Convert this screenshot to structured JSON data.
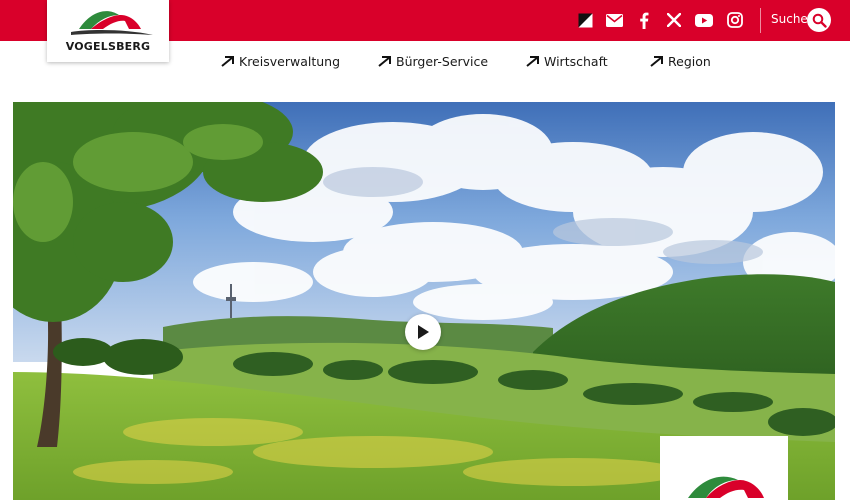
{
  "header": {
    "logo_text": "VOGELSBERG",
    "social": [
      {
        "name": "contrast-icon"
      },
      {
        "name": "mail-icon"
      },
      {
        "name": "facebook-icon"
      },
      {
        "name": "x-icon"
      },
      {
        "name": "youtube-icon"
      },
      {
        "name": "instagram-icon"
      }
    ],
    "search_label": "Suche"
  },
  "nav": {
    "items": [
      {
        "label": "Kreisverwaltung"
      },
      {
        "label": "Bürger-Service"
      },
      {
        "label": "Wirtschaft"
      },
      {
        "label": "Region"
      }
    ]
  },
  "hero": {
    "media": "landscape-photo",
    "play_icon": "play-icon"
  },
  "colors": {
    "brand_red": "#d9002a",
    "logo_green": "#2e8b3c",
    "text_dark": "#1a1a1a",
    "white": "#ffffff"
  }
}
